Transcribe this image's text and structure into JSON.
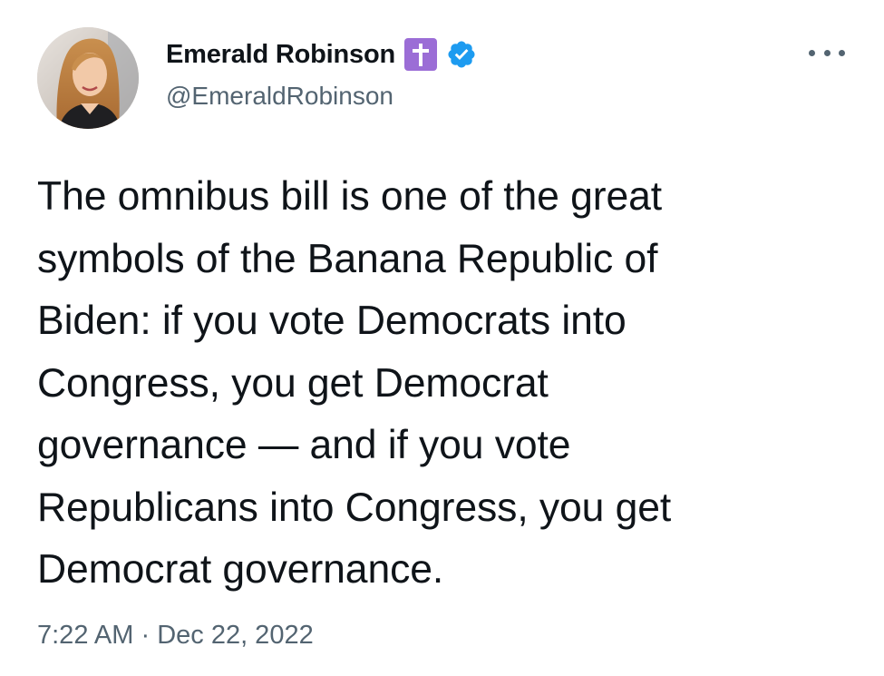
{
  "author": {
    "display_name": "Emerald Robinson",
    "handle": "@EmeraldRobinson",
    "badges": [
      "cross-icon",
      "verified-icon"
    ],
    "avatar": "profile-photo"
  },
  "menu": {
    "icon": "more-horizontal-icon"
  },
  "tweet": {
    "text": "The omnibus bill is one of the great\nsymbols of the Banana Republic of\nBiden: if you vote Democrats into\nCongress, you get Democrat\ngovernance — and if you vote\nRepublicans into Congress, you get\nDemocrat governance.",
    "time": "7:22 AM",
    "separator": " · ",
    "date": "Dec 22, 2022"
  },
  "colors": {
    "text": "#0f1419",
    "secondary": "#536471",
    "verified": "#1d9bf0",
    "cross_badge": "#9b6dd6"
  }
}
